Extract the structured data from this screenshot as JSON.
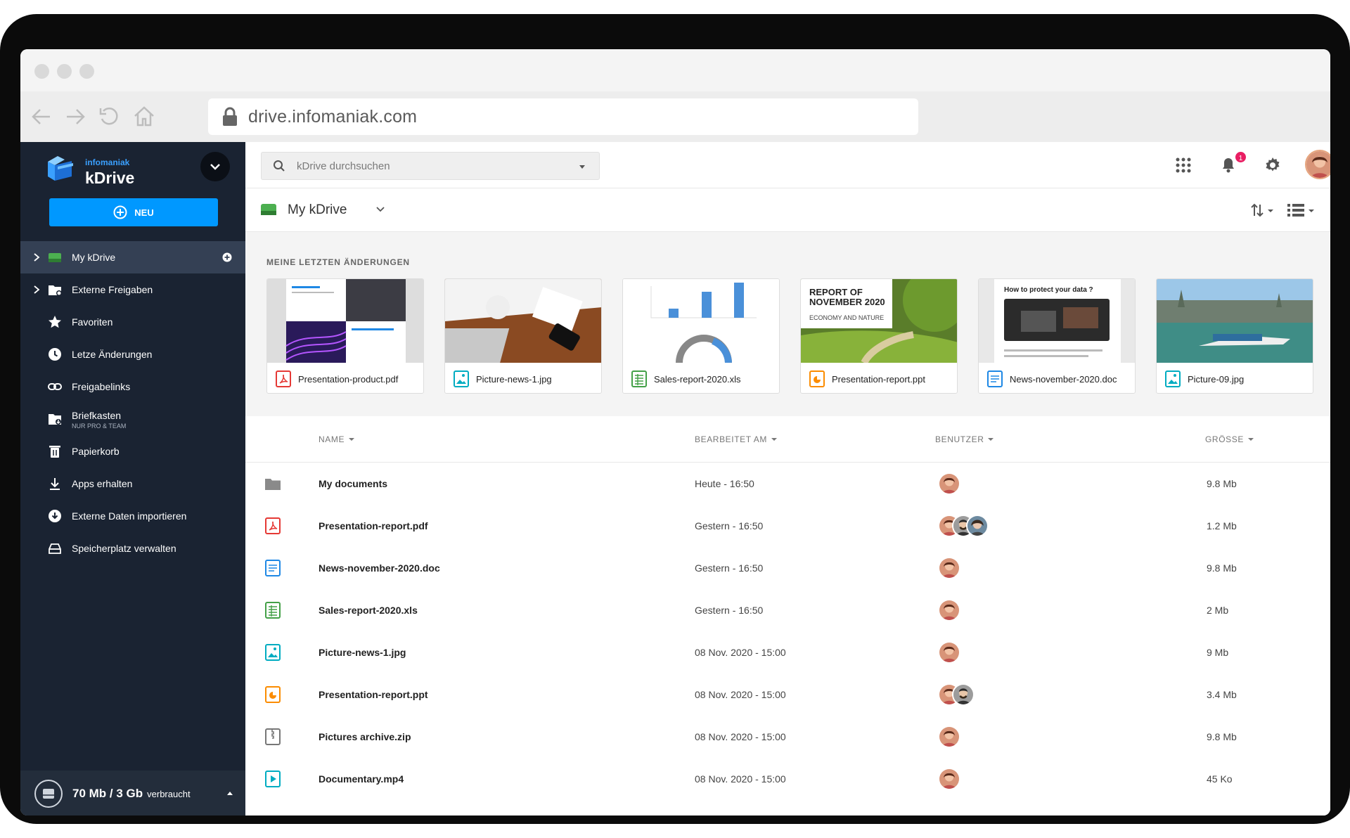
{
  "browser": {
    "url": "drive.infomaniak.com"
  },
  "brand": {
    "company": "infomaniak",
    "product": "kDrive"
  },
  "sidebar": {
    "new_label": "NEU",
    "items": [
      {
        "label": "My kDrive"
      },
      {
        "label": "Externe Freigaben"
      },
      {
        "label": "Favoriten"
      },
      {
        "label": "Letze Änderungen"
      },
      {
        "label": "Freigabelinks"
      },
      {
        "label": "Briefkasten",
        "sub": "NUR PRO & TEAM"
      },
      {
        "label": "Papierkorb"
      },
      {
        "label": "Apps erhalten"
      },
      {
        "label": "Externe Daten importieren"
      },
      {
        "label": "Speicherplatz verwalten"
      }
    ],
    "storage": {
      "used": "70 Mb / 3 Gb",
      "suffix": "verbraucht"
    }
  },
  "search": {
    "placeholder": "kDrive durchsuchen"
  },
  "notifications": {
    "count": "1"
  },
  "breadcrumb": {
    "title": "My kDrive"
  },
  "recent": {
    "heading": "MEINE LETZTEN ÄNDERUNGEN",
    "cards": [
      {
        "name": "Presentation-product.pdf",
        "type": "pdf"
      },
      {
        "name": "Picture-news-1.jpg",
        "type": "image"
      },
      {
        "name": "Sales-report-2020.xls",
        "type": "sheet"
      },
      {
        "name": "Presentation-report.ppt",
        "type": "ppt",
        "thumb_title": "REPORT OF NOVEMBER 2020",
        "thumb_sub": "ECONOMY AND NATURE"
      },
      {
        "name": "News-november-2020.doc",
        "type": "doc",
        "thumb_title": "How to protect your data ?"
      },
      {
        "name": "Picture-09.jpg",
        "type": "image"
      }
    ]
  },
  "table": {
    "columns": {
      "name": "NAME",
      "edited": "BEARBEITET AM",
      "users": "BENUTZER",
      "size": "GRÖSSE"
    },
    "rows": [
      {
        "name": "My documents",
        "date": "Heute - 16:50",
        "size": "9.8 Mb",
        "type": "folder",
        "users": 1
      },
      {
        "name": "Presentation-report.pdf",
        "date": "Gestern - 16:50",
        "size": "1.2 Mb",
        "type": "pdf",
        "users": 3
      },
      {
        "name": "News-november-2020.doc",
        "date": "Gestern - 16:50",
        "size": "9.8 Mb",
        "type": "doc",
        "users": 1
      },
      {
        "name": "Sales-report-2020.xls",
        "date": "Gestern - 16:50",
        "size": "2 Mb",
        "type": "sheet",
        "users": 1
      },
      {
        "name": "Picture-news-1.jpg",
        "date": "08 Nov. 2020 - 15:00",
        "size": "9 Mb",
        "type": "image",
        "users": 1
      },
      {
        "name": "Presentation-report.ppt",
        "date": "08 Nov. 2020 - 15:00",
        "size": "3.4 Mb",
        "type": "ppt",
        "users": 2
      },
      {
        "name": "Pictures archive.zip",
        "date": "08 Nov. 2020 - 15:00",
        "size": "9.8 Mb",
        "type": "zip",
        "users": 1
      },
      {
        "name": "Documentary.mp4",
        "date": "08 Nov. 2020 - 15:00",
        "size": "45 Ko",
        "type": "video",
        "users": 1
      }
    ]
  },
  "colors": {
    "accent": "#0098ff",
    "sidebar": "#1a2332",
    "pdf": "#e53935",
    "doc": "#1e88e5",
    "sheet": "#43a047",
    "image": "#00acc1",
    "ppt": "#fb8c00"
  }
}
